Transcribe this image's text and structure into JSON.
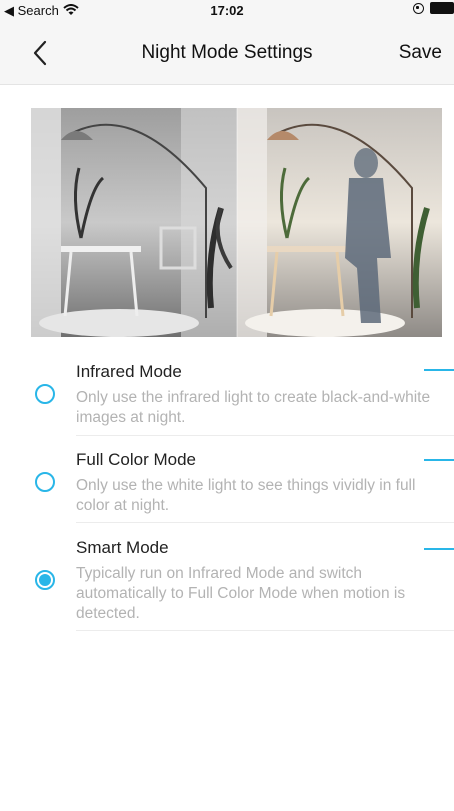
{
  "status_bar": {
    "back_label": "◀ Search",
    "time": "17:02"
  },
  "nav": {
    "title": "Night Mode Settings",
    "save_label": "Save"
  },
  "options": [
    {
      "title": "Infrared Mode",
      "description": "Only use the infrared light to create black-and-white images at night.",
      "selected": false
    },
    {
      "title": "Full Color Mode",
      "description": "Only use the white light to see things vividly in full color at night.",
      "selected": false
    },
    {
      "title": "Smart Mode",
      "description": "Typically run on Infrared Mode and switch automatically to Full Color Mode when motion is detected.",
      "selected": true
    }
  ],
  "colors": {
    "accent": "#29b6e8",
    "description_text": "#b3b3b3"
  }
}
